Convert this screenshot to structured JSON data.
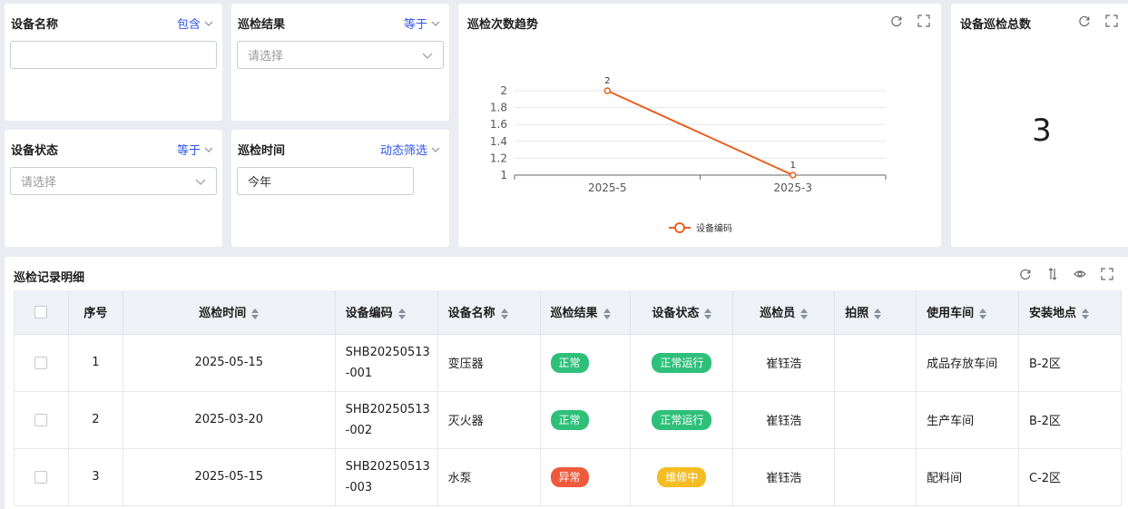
{
  "filters": [
    {
      "title": "设备名称",
      "op": "包含",
      "value": "",
      "placeholder": "",
      "dropdown": false
    },
    {
      "title": "巡检结果",
      "op": "等于",
      "value": "",
      "placeholder": "请选择",
      "dropdown": true
    },
    {
      "title": "设备状态",
      "op": "等于",
      "value": "",
      "placeholder": "请选择",
      "dropdown": true
    },
    {
      "title": "巡检时间",
      "op": "动态筛选",
      "value": "今年",
      "placeholder": "",
      "dropdown": false
    }
  ],
  "trend": {
    "title": "巡检次数趋势",
    "icons": [
      "refresh-icon",
      "fullscreen-icon"
    ]
  },
  "total": {
    "title": "设备巡检总数",
    "value": "3",
    "icons": [
      "refresh-icon",
      "fullscreen-icon"
    ]
  },
  "chart_data": {
    "type": "line",
    "categories": [
      "2025-5",
      "2025-3"
    ],
    "series": [
      {
        "name": "设备编码",
        "values": [
          2,
          1
        ],
        "color": "#e8601c"
      }
    ],
    "ylim": [
      1,
      2
    ],
    "yticks": [
      "1",
      "1.2",
      "1.4",
      "1.6",
      "1.8",
      "2"
    ],
    "data_labels": [
      "2",
      "1"
    ],
    "grid": true,
    "legend_position": "bottom"
  },
  "records": {
    "title": "巡检记录明细",
    "tool_icons": [
      "refresh-icon",
      "column-height-icon",
      "eye-icon",
      "fullscreen-icon"
    ],
    "columns": [
      "序号",
      "巡检时间",
      "设备编码",
      "设备名称",
      "巡检结果",
      "设备状态",
      "巡检员",
      "拍照",
      "使用车间",
      "安装地点"
    ],
    "rows": [
      {
        "no": "1",
        "time": "2025-05-15",
        "code_1": "SHB20250513",
        "code_2": "-001",
        "name": "变压器",
        "result": "正常",
        "result_color": "#2ec07a",
        "status": "正常运行",
        "status_color": "#2ec07a",
        "inspector": "崔钰浩",
        "photo": "",
        "workshop": "成品存放车间",
        "location": "B-2区"
      },
      {
        "no": "2",
        "time": "2025-03-20",
        "code_1": "SHB20250513",
        "code_2": "-002",
        "name": "灭火器",
        "result": "正常",
        "result_color": "#2ec07a",
        "status": "正常运行",
        "status_color": "#2ec07a",
        "inspector": "崔钰浩",
        "photo": "",
        "workshop": "生产车间",
        "location": "B-2区"
      },
      {
        "no": "3",
        "time": "2025-05-15",
        "code_1": "SHB20250513",
        "code_2": "-003",
        "name": "水泵",
        "result": "异常",
        "result_color": "#ee5a3c",
        "status": "维修中",
        "status_color": "#f5bc23",
        "inspector": "崔钰浩",
        "photo": "",
        "workshop": "配料间",
        "location": "C-2区"
      }
    ]
  }
}
